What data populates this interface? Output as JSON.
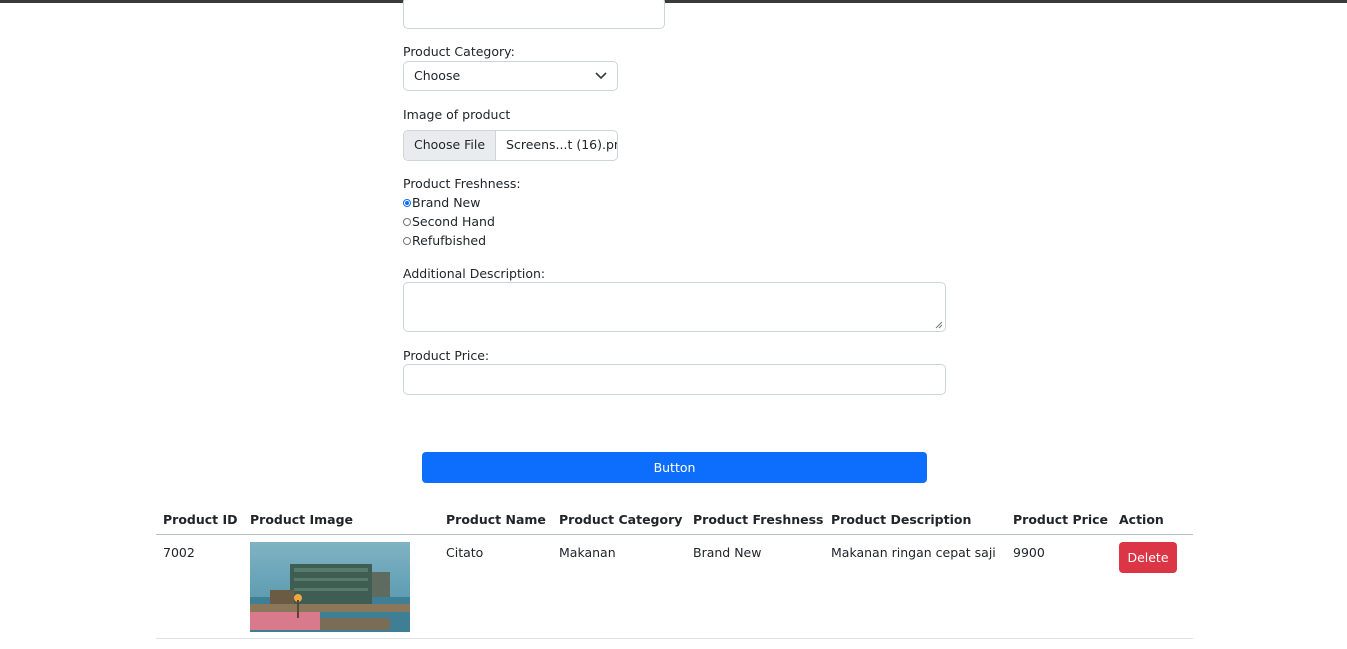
{
  "form": {
    "category_label": "Product Category:",
    "category_selected": "Choose",
    "image_label": "Image of product",
    "file_button": "Choose File",
    "file_name": "Screens...t (16).png",
    "freshness_label": "Product Freshness:",
    "freshness_options": [
      "Brand New",
      "Second Hand",
      "Refufbished"
    ],
    "freshness_selected": "Brand New",
    "description_label": "Additional Description:",
    "description_value": "",
    "price_label": "Product Price:",
    "price_value": "",
    "submit_label": "Button"
  },
  "table": {
    "headers": [
      "Product ID",
      "Product Image",
      "Product Name",
      "Product Category",
      "Product Freshness",
      "Product Description",
      "Product Price",
      "Action"
    ],
    "rows": [
      {
        "id": "7002",
        "name": "Citato",
        "category": "Makanan",
        "freshness": "Brand New",
        "description": "Makanan ringan cepat saji",
        "price": "9900",
        "action": "Delete"
      }
    ]
  },
  "colors": {
    "primary": "#0d6efd",
    "danger": "#dc3545"
  }
}
